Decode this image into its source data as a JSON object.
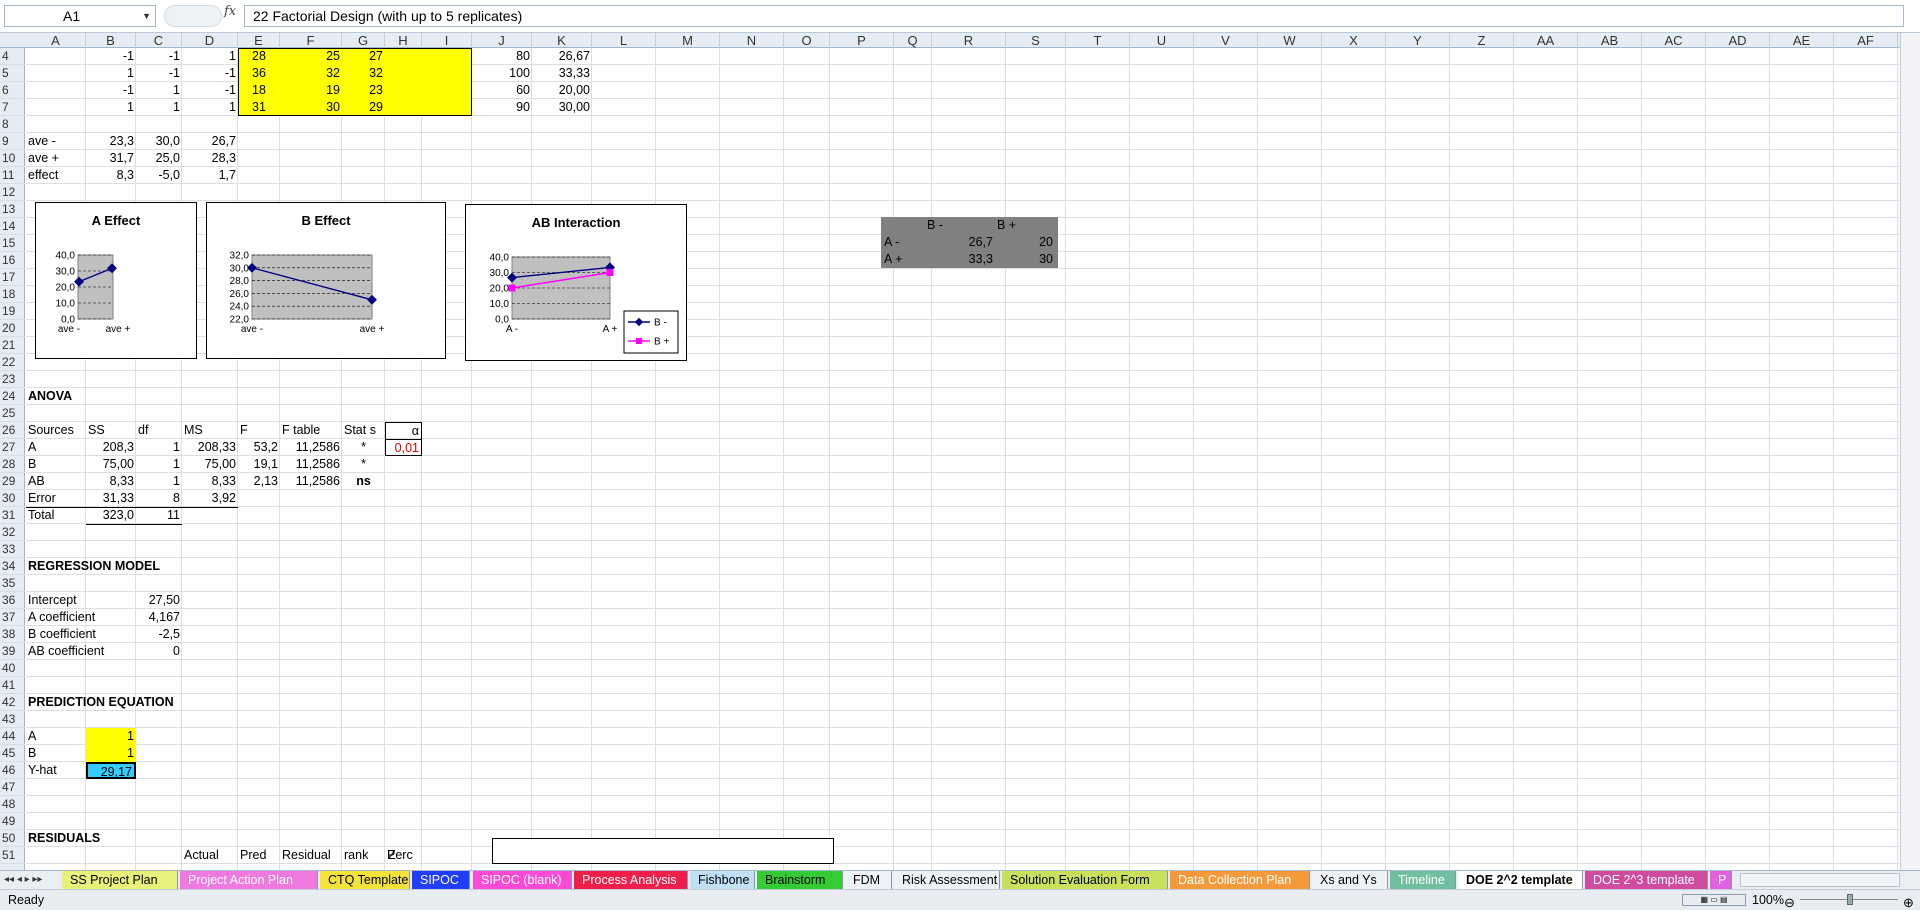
{
  "formula_bar": {
    "name_box": "A1",
    "fx_label": "fx",
    "formula": "22 Factorial Design (with up to 5 replicates)"
  },
  "columns": [
    "A",
    "B",
    "C",
    "D",
    "E",
    "F",
    "G",
    "H",
    "I",
    "J",
    "K",
    "L",
    "M",
    "N",
    "O",
    "P",
    "Q",
    "R",
    "S",
    "T",
    "U",
    "V",
    "W",
    "X",
    "Y",
    "Z",
    "AA",
    "AB",
    "AC",
    "AD",
    "AE",
    "AF"
  ],
  "rows": [
    "4",
    "5",
    "6",
    "7",
    "8",
    "9",
    "10",
    "11",
    "12",
    "13",
    "14",
    "15",
    "16",
    "17",
    "18",
    "19",
    "20",
    "21",
    "22",
    "23",
    "24",
    "25",
    "26",
    "27",
    "28",
    "29",
    "30",
    "31",
    "32",
    "33",
    "34",
    "35",
    "36",
    "37",
    "38",
    "39",
    "40",
    "41",
    "42",
    "43",
    "44",
    "45",
    "46",
    "47",
    "48",
    "49",
    "50",
    "51"
  ],
  "design": [
    {
      "B": "-1",
      "C": "-1",
      "D": "1",
      "E": "28",
      "F": "25",
      "G": "27",
      "J": "80",
      "K": "26,67"
    },
    {
      "B": "1",
      "C": "-1",
      "D": "-1",
      "E": "36",
      "F": "32",
      "G": "32",
      "J": "100",
      "K": "33,33"
    },
    {
      "B": "-1",
      "C": "1",
      "D": "-1",
      "E": "18",
      "F": "19",
      "G": "23",
      "J": "60",
      "K": "20,00"
    },
    {
      "B": "1",
      "C": "1",
      "D": "1",
      "E": "31",
      "F": "30",
      "G": "29",
      "J": "90",
      "K": "30,00"
    }
  ],
  "averages": [
    {
      "label": "ave -",
      "B": "23,3",
      "C": "30,0",
      "D": "26,7"
    },
    {
      "label": "ave +",
      "B": "31,7",
      "C": "25,0",
      "D": "28,3"
    },
    {
      "label": "effect",
      "B": "8,3",
      "C": "-5,0",
      "D": "1,7"
    }
  ],
  "anova": {
    "title": "ANOVA",
    "headers": [
      "Sources",
      "SS",
      "df",
      "MS",
      "F",
      "F table",
      "Stat s",
      "α"
    ],
    "rows": [
      {
        "src": "A",
        "ss": "208,3",
        "df": "1",
        "ms": "208,33",
        "f": "53,2",
        "ft": "11,2586",
        "sig": "*"
      },
      {
        "src": "B",
        "ss": "75,00",
        "df": "1",
        "ms": "75,00",
        "f": "19,1",
        "ft": "11,2586",
        "sig": "*"
      },
      {
        "src": "AB",
        "ss": "8,33",
        "df": "1",
        "ms": "8,33",
        "f": "2,13",
        "ft": "11,2586",
        "sig": "ns"
      },
      {
        "src": "Error",
        "ss": "31,33",
        "df": "8",
        "ms": "3,92",
        "f": "",
        "ft": "",
        "sig": ""
      },
      {
        "src": "Total",
        "ss": "323,0",
        "df": "11",
        "ms": "",
        "f": "",
        "ft": "",
        "sig": ""
      }
    ],
    "alpha": "0,01"
  },
  "regression": {
    "title": "REGRESSION MODEL",
    "rows": [
      {
        "label": "Intercept",
        "value": "27,50"
      },
      {
        "label": "A coefficient",
        "value": "4,167"
      },
      {
        "label": "B coefficient",
        "value": "-2,5"
      },
      {
        "label": "AB coefficient",
        "value": "0"
      }
    ]
  },
  "prediction": {
    "title": "PREDICTION EQUATION",
    "a_label": "A",
    "a": "1",
    "b_label": "B",
    "b": "1",
    "yhat_label": "Y-hat",
    "yhat": "29,17"
  },
  "residuals": {
    "title": "RESIDUALS",
    "headers": [
      "Actual",
      "Pred",
      "Residual",
      "rank",
      "Perc",
      "Z"
    ]
  },
  "interaction_table": {
    "bm": "B -",
    "bp": "B +",
    "am": "A -",
    "ap": "A +",
    "v11": "26,7",
    "v12": "20",
    "v21": "33,3",
    "v22": "30"
  },
  "chart_data": [
    {
      "type": "line",
      "title": "A Effect",
      "categories": [
        "ave -",
        "ave +"
      ],
      "values": [
        23.3,
        31.7
      ],
      "ylim": [
        0,
        40
      ],
      "yticks": [
        "40,0",
        "30,0",
        "20,0",
        "10,0",
        "0,0"
      ]
    },
    {
      "type": "line",
      "title": "B Effect",
      "categories": [
        "ave -",
        "ave +"
      ],
      "values": [
        30.0,
        25.0
      ],
      "ylim": [
        22,
        32
      ],
      "yticks": [
        "32,0",
        "30,0",
        "28,0",
        "26,0",
        "24,0",
        "22,0"
      ]
    },
    {
      "type": "line",
      "title": "AB Interaction",
      "categories": [
        "A -",
        "A +"
      ],
      "series": [
        {
          "name": "B -",
          "values": [
            26.7,
            33.3
          ]
        },
        {
          "name": "B +",
          "values": [
            20,
            30
          ]
        }
      ],
      "ylim": [
        0,
        40
      ],
      "yticks": [
        "40,0",
        "30,0",
        "20,0",
        "10,0",
        "0,0"
      ]
    }
  ],
  "tabs": [
    {
      "label": "SS Project Plan",
      "color": "#e8f27a",
      "fg": "#000"
    },
    {
      "label": "Project Action Plan",
      "color": "#f079e0",
      "fg": "#fff"
    },
    {
      "label": "CTQ Template",
      "color": "#f5e33a",
      "fg": "#000"
    },
    {
      "label": "SIPOC",
      "color": "#1f3dff",
      "fg": "#fff"
    },
    {
      "label": "SIPOC (blank)",
      "color": "#ff4ad8",
      "fg": "#fff"
    },
    {
      "label": "Process Analysis",
      "color": "#f01f4a",
      "fg": "#fff"
    },
    {
      "label": "Fishbone",
      "color": "#bfe0f7",
      "fg": "#000"
    },
    {
      "label": "Brainstorm",
      "color": "#33cc33",
      "fg": "#000"
    },
    {
      "label": "FDM",
      "color": "#eef2f7",
      "fg": "#000"
    },
    {
      "label": "Risk Assessment",
      "color": "#eef2f7",
      "fg": "#000"
    },
    {
      "label": "Solution Evaluation Form",
      "color": "#c8e05a",
      "fg": "#000"
    },
    {
      "label": "Data Collection Plan",
      "color": "#f59a3a",
      "fg": "#fff"
    },
    {
      "label": "Xs and Ys",
      "color": "#eef2f7",
      "fg": "#000"
    },
    {
      "label": "Timeline",
      "color": "#6fbfa0",
      "fg": "#fff"
    },
    {
      "label": "DOE 2^2 template",
      "color": "#ffffff",
      "fg": "#000"
    },
    {
      "label": "DOE 2^3 template",
      "color": "#d04aa0",
      "fg": "#fff"
    },
    {
      "label": "P",
      "color": "#e060e0",
      "fg": "#fff"
    }
  ],
  "status": {
    "ready": "Ready",
    "zoom": "100%"
  }
}
